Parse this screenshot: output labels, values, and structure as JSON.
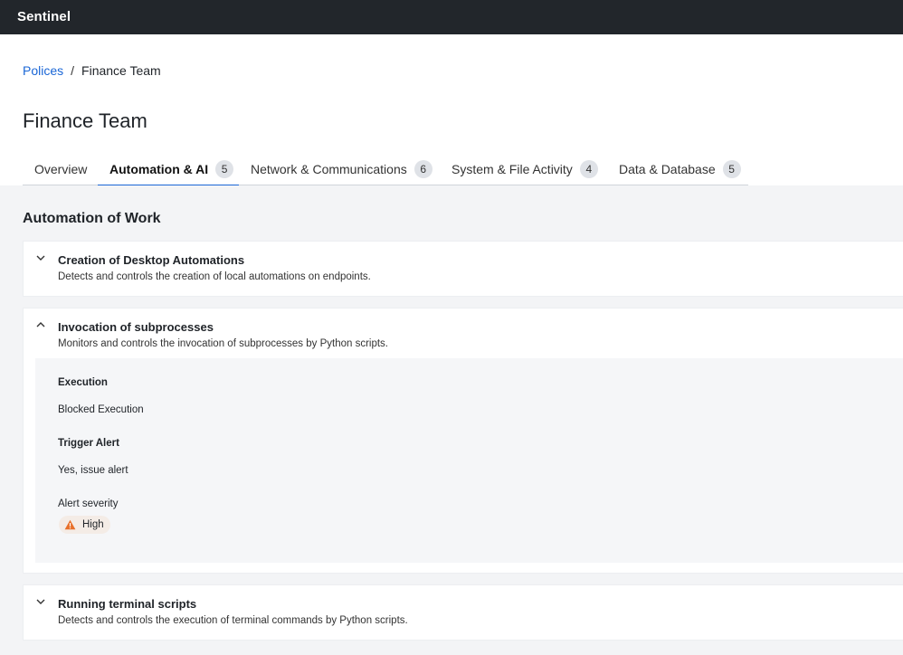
{
  "app": {
    "name": "Sentinel"
  },
  "breadcrumb": {
    "root": "Polices",
    "separator": "/",
    "current": "Finance Team"
  },
  "page": {
    "title": "Finance Team"
  },
  "tabs": [
    {
      "label": "Overview",
      "count": null,
      "active": false
    },
    {
      "label": "Automation & AI",
      "count": "5",
      "active": true
    },
    {
      "label": "Network & Communications",
      "count": "6",
      "active": false
    },
    {
      "label": "System & File Activity",
      "count": "4",
      "active": false
    },
    {
      "label": "Data & Database",
      "count": "5",
      "active": false
    }
  ],
  "section": {
    "title": "Automation of Work"
  },
  "policies": [
    {
      "title": "Creation of Desktop Automations",
      "description": "Detects and controls the creation of local automations on endpoints.",
      "expanded": false,
      "chevron_icon": "chevron-down-icon"
    },
    {
      "title": "Invocation of subprocesses",
      "description": "Monitors and controls the invocation of subprocesses by Python scripts.",
      "expanded": true,
      "chevron_icon": "chevron-up-icon",
      "details": {
        "execution_label": "Execution",
        "execution_value": "Blocked Execution",
        "alert_label": "Trigger Alert",
        "alert_value": "Yes, issue alert",
        "severity_label": "Alert severity",
        "severity_value": "High",
        "severity_icon": "warning-icon",
        "severity_color": "#e8702a"
      }
    },
    {
      "title": "Running terminal scripts",
      "description": "Detects and controls the execution of terminal commands by Python scripts.",
      "expanded": false,
      "chevron_icon": "chevron-down-icon"
    }
  ],
  "colors": {
    "accent": "#1a66d6",
    "topbar": "#22262b",
    "warning": "#e8702a"
  }
}
